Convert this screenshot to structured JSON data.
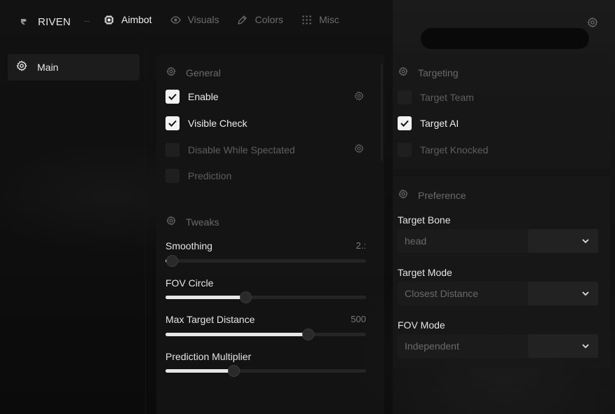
{
  "brand": {
    "name": "RIVEN",
    "logo_icon": "riven-logo-icon"
  },
  "tabs": [
    {
      "label": "Aimbot",
      "icon": "chip-icon",
      "active": true
    },
    {
      "label": "Visuals",
      "icon": "eye-icon",
      "active": false
    },
    {
      "label": "Colors",
      "icon": "pen-icon",
      "active": false
    },
    {
      "label": "Misc",
      "icon": "grid-dots-icon",
      "active": false
    }
  ],
  "sidebar": {
    "items": [
      {
        "label": "Main",
        "icon": "gear-icon"
      }
    ]
  },
  "general": {
    "title": "General",
    "items": [
      {
        "label": "Enable",
        "checked": true
      },
      {
        "label": "Visible Check",
        "checked": true
      },
      {
        "label": "Disable While Spectated",
        "checked": false
      },
      {
        "label": "Prediction",
        "checked": false
      }
    ]
  },
  "tweaks": {
    "title": "Tweaks",
    "sliders": [
      {
        "label": "Smoothing",
        "value": "2.:",
        "fraction": 0.03
      },
      {
        "label": "FOV Circle",
        "value": "",
        "fraction": 0.4
      },
      {
        "label": "Max Target Distance",
        "value": "500",
        "fraction": 0.71
      },
      {
        "label": "Prediction Multiplier",
        "value": "",
        "fraction": 0.34
      }
    ]
  },
  "targeting": {
    "title": "Targeting",
    "items": [
      {
        "label": "Target Team",
        "checked": false
      },
      {
        "label": "Target AI",
        "checked": true
      },
      {
        "label": "Target Knocked",
        "checked": false
      }
    ]
  },
  "preference": {
    "title": "Preference",
    "fields": [
      {
        "label": "Target Bone",
        "value": "head"
      },
      {
        "label": "Target Mode",
        "value": "Closest Distance"
      },
      {
        "label": "FOV Mode",
        "value": "Independent"
      }
    ]
  },
  "colors": {
    "bg": "#0d0d0d",
    "panel": "#181818",
    "check_on": "#f2f2f2",
    "accent_text": "#e8e8e8",
    "muted_text": "#6a6a6a"
  }
}
